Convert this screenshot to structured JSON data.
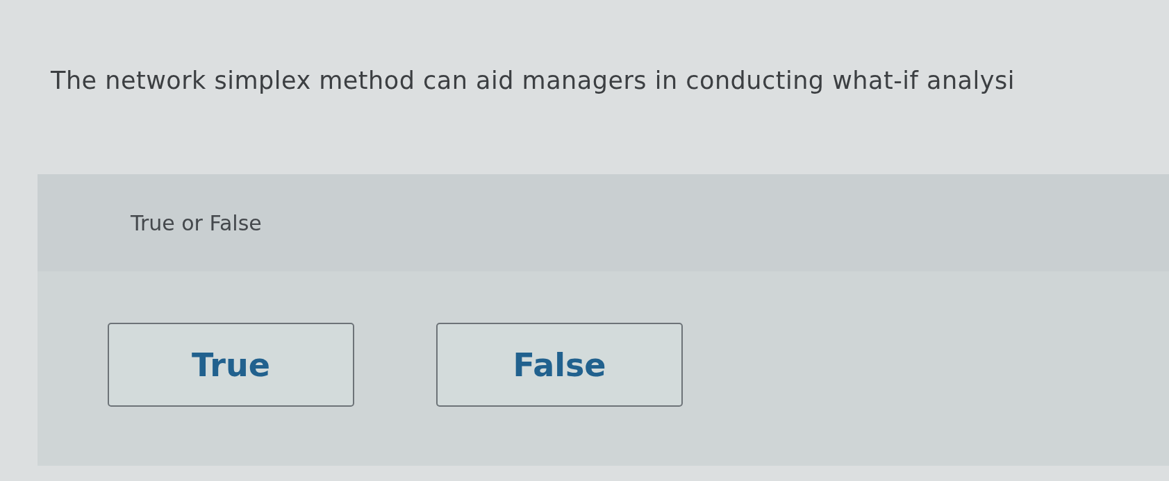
{
  "question": "The network simplex method can aid managers in conducting what-if analysi",
  "prompt": "True or False",
  "choices": [
    "True",
    "False"
  ]
}
